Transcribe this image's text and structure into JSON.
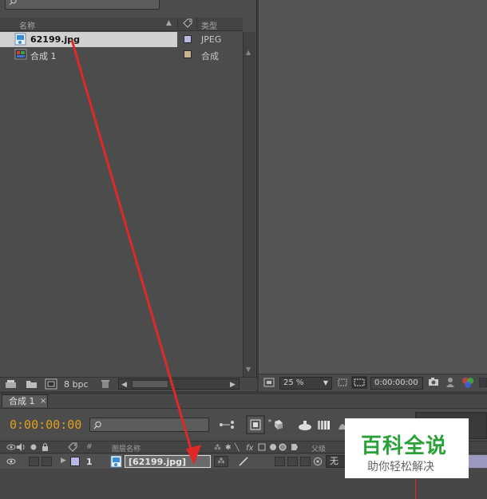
{
  "project": {
    "columns": {
      "name": "名称",
      "type": "类型"
    },
    "items": [
      {
        "name": "62199.jpg",
        "type": "JPEG",
        "label_color": "#b8b8e6",
        "selected": true
      },
      {
        "name": "合成 1",
        "type": "合成",
        "label_color": "#c8b48c",
        "selected": false
      }
    ],
    "bpc": "8 bpc"
  },
  "viewer": {
    "zoom": "25 %",
    "timecode": "0:00:00:00"
  },
  "timeline": {
    "tab_label": "合成 1",
    "current_time": "0:00:00:00",
    "col_hash": "#",
    "col_layer_name": "图层名称",
    "col_parent": "父级",
    "layer": {
      "index": "1",
      "name": "[62199.jpg]",
      "parent": "无",
      "label_color": "#b8b8e6"
    }
  },
  "watermark": {
    "title": "百科全说",
    "subtitle": "助你轻松解决"
  },
  "colors": {
    "accent_time": "#e0a020",
    "arrow": "#e02828",
    "selection": "#d0d0d0"
  }
}
